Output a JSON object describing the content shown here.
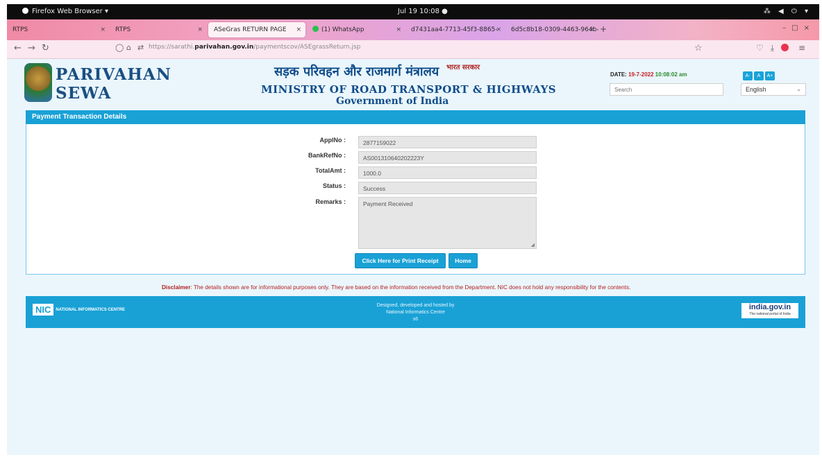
{
  "system_bar": {
    "app_name": "Firefox Web Browser ▾",
    "clock": "Jul 19  10:08  ●",
    "status_icons": "⁂ ◀ ⏻ ▾"
  },
  "browser": {
    "tabs": [
      {
        "label": "RTPS",
        "active": false
      },
      {
        "label": "RTPS",
        "active": false
      },
      {
        "label": "ASeGras RETURN PAGE",
        "active": true
      },
      {
        "label": "(1) WhatsApp",
        "active": false
      },
      {
        "label": "d7431aa4-7713-45f3-8865-",
        "active": false
      },
      {
        "label": "6d5c8b18-0309-4463-964b-",
        "active": false
      }
    ],
    "tab_close": "×",
    "new_tab": "+",
    "url_prefix": "https://sarathi.",
    "url_domain": "parivahan.gov.in",
    "url_path": "/paymentscov/ASEgrassReturn.jsp"
  },
  "header": {
    "logo_line1": "PARIVAHAN",
    "logo_line2": "SEWA",
    "hindi_title": "सड़क परिवहन और राजमार्ग मंत्रालय",
    "hindi_small": "भारत सरकार",
    "ministry": "MINISTRY OF ROAD TRANSPORT & HIGHWAYS",
    "government": "Government of India",
    "date_label": "DATE: ",
    "date_value": "19-7-2022",
    "time_value": " 10:08:02 am",
    "search_placeholder": "Search",
    "language": "English",
    "font_buttons": [
      "A-",
      "A",
      "A+"
    ]
  },
  "panel": {
    "title": "Payment Transaction Details",
    "fields": [
      {
        "label": "ApplNo :",
        "value": "2877159022"
      },
      {
        "label": "BankRefNo :",
        "value": "AS001310640202223Y"
      },
      {
        "label": "TotalAmt :",
        "value": "1000.0"
      },
      {
        "label": "Status :",
        "value": "Success"
      },
      {
        "label": "Remarks :",
        "value": "Payment Received"
      }
    ],
    "print_button": "Click Here for Print Receipt",
    "home_button": "Home"
  },
  "disclaimer": {
    "label": "Disclaimer",
    "text": ": The details shown are for informational purposes only. They are based on the information received from the Department. NIC does not hold any responsibility for the contents."
  },
  "footer": {
    "nic_box": "NIC",
    "nic_text": "NATIONAL INFORMATICS CENTRE",
    "credit_line1": "Designed, developed and hosted by",
    "credit_line2": "National Informatics Centre",
    "credit_line3": "s6",
    "india_gov": "india.gov.in",
    "india_gov_tag": "The national portal of India"
  },
  "colors": {
    "accent": "#19a1d6",
    "disclaimer": "#b31f1f",
    "title_blue": "#0f4c8a"
  }
}
